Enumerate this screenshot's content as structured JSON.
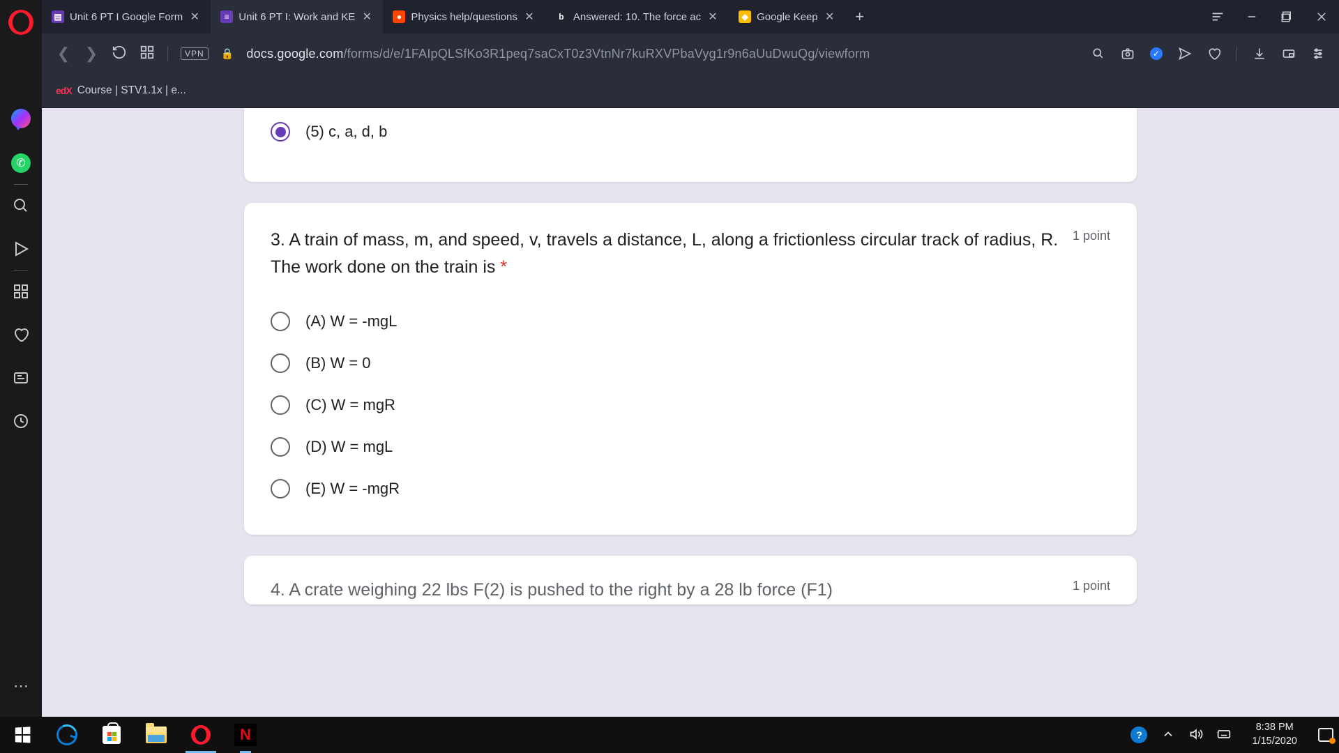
{
  "tabs": [
    {
      "label": "Unit 6 PT I Google Form"
    },
    {
      "label": "Unit 6 PT I: Work and KE"
    },
    {
      "label": "Physics help/questions"
    },
    {
      "label": "Answered: 10. The force ac"
    },
    {
      "label": "Google Keep"
    }
  ],
  "vpn": "VPN",
  "url_prefix": "docs.google.com",
  "url_path": "/forms/d/e/1FAIpQLSfKo3R1peq7saCxT0z3VtnNr7kuRXVPbaVyg1r9n6aUuDwuQg/viewform",
  "bookmark": "Course | STV1.1x | e...",
  "q2_option5": "(5) c, a, d, b",
  "q3": {
    "text": "3. A train of mass, m, and speed, v, travels a distance, L, along a frictionless circular track of radius, R. The work done on the train is ",
    "points": "1 point",
    "options": [
      "(A) W = -mgL",
      "(B) W = 0",
      "(C) W = mgR",
      "(D) W = mgL",
      "(E) W = -mgR"
    ]
  },
  "q4": {
    "text": "4. A crate weighing 22 lbs F(2) is pushed to the right by a 28 lb force (F1)",
    "points": "1 point"
  },
  "clock": {
    "time": "8:38 PM",
    "date": "1/15/2020"
  }
}
